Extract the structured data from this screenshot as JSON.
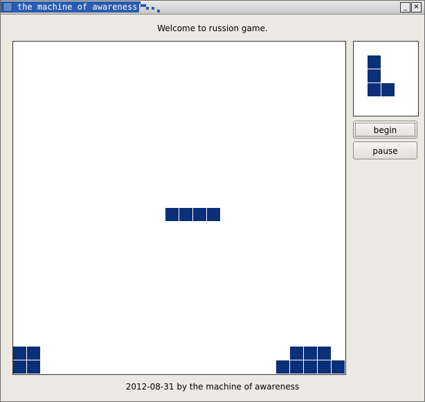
{
  "window": {
    "title": "the machine of awareness",
    "minimize_glyph": "_",
    "close_glyph": "✕"
  },
  "header": {
    "welcome": "Welcome to russion game."
  },
  "controls": {
    "begin_label": "begin",
    "pause_label": "pause"
  },
  "footer": {
    "text": "2012-08-31 by the machine of awareness"
  },
  "colors": {
    "block": "#0b2f78",
    "board_bg": "#ffffff",
    "window_bg": "#ece9e3"
  },
  "game": {
    "columns": 24,
    "rows": 24,
    "falling_piece": {
      "shape": "I",
      "cells": [
        [
          11,
          12
        ],
        [
          12,
          12
        ],
        [
          13,
          12
        ],
        [
          14,
          12
        ]
      ]
    },
    "settled_cells": [
      [
        0,
        22
      ],
      [
        1,
        22
      ],
      [
        0,
        23
      ],
      [
        1,
        23
      ],
      [
        20,
        22
      ],
      [
        21,
        22
      ],
      [
        22,
        22
      ],
      [
        19,
        23
      ],
      [
        20,
        23
      ],
      [
        21,
        23
      ],
      [
        22,
        23
      ],
      [
        23,
        23
      ]
    ],
    "next_piece": {
      "shape": "L",
      "cells": [
        [
          0,
          0
        ],
        [
          0,
          1
        ],
        [
          0,
          2
        ],
        [
          1,
          2
        ]
      ]
    }
  }
}
